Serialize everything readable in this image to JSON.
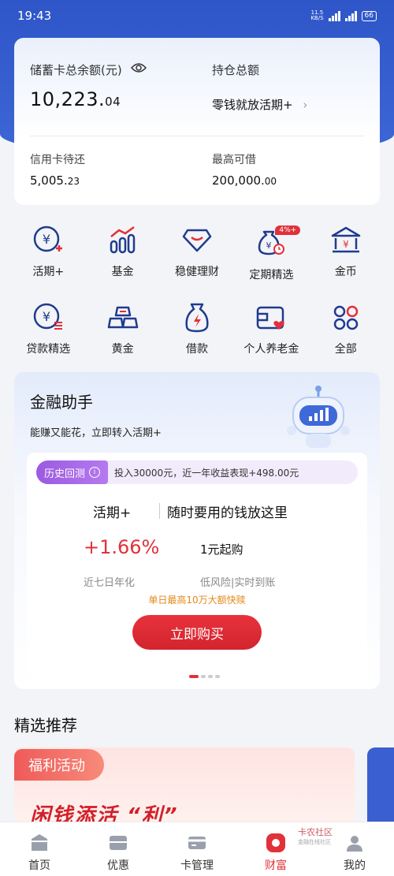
{
  "status_bar": {
    "time": "19:43",
    "net_speed": "11.5",
    "net_unit": "KB/S",
    "sig1": "5G",
    "sig2": "4G",
    "battery": "66"
  },
  "account": {
    "savings_label": "储蓄卡总余额(元)",
    "savings_int": "10,223.",
    "savings_dec": "04",
    "holdings_label": "持仓总额",
    "holdings_link": "零钱就放活期+",
    "credit_label": "信用卡待还",
    "credit_int": "5,005.",
    "credit_dec": "23",
    "max_label": "最高可借",
    "max_int": "200,000.",
    "max_dec": "00"
  },
  "grid": [
    {
      "label": "活期+",
      "icon": "yuan-plus-icon"
    },
    {
      "label": "基金",
      "icon": "fund-chart-icon"
    },
    {
      "label": "稳健理财",
      "icon": "diamond-icon"
    },
    {
      "label": "定期精选",
      "icon": "money-bag-clock-icon",
      "badge": "4%+"
    },
    {
      "label": "金币",
      "icon": "bank-icon"
    },
    {
      "label": "贷款精选",
      "icon": "yuan-coin-icon"
    },
    {
      "label": "黄金",
      "icon": "gold-bars-icon"
    },
    {
      "label": "借款",
      "icon": "bag-lightning-icon"
    },
    {
      "label": "个人养老金",
      "icon": "wallet-heart-icon"
    },
    {
      "label": "全部",
      "icon": "four-circles-icon"
    }
  ],
  "assistant": {
    "title": "金融助手",
    "subtitle": "能赚又能花，立即转入活期+",
    "history_tag": "历史回测",
    "history_info": "i",
    "history_text": "投入30000元，近一年收益表现+498.00元",
    "product": "活期+",
    "slogan": "随时要用的钱放这里",
    "rate": "+1.66%",
    "min_buy": "1元起购",
    "rate_label": "近七日年化",
    "risk_label": "低风险|实时到账",
    "promo": "单日最高10万大额快赎",
    "buy_button": "立即购买"
  },
  "recommend": {
    "title": "精选推荐",
    "promo_tag": "福利活动",
    "promo_text": "闲钱添活 “利”"
  },
  "tabs": [
    {
      "label": "首页",
      "icon": "home-icon"
    },
    {
      "label": "优惠",
      "icon": "coupon-icon"
    },
    {
      "label": "卡管理",
      "icon": "card-icon"
    },
    {
      "label": "财富",
      "icon": "wealth-icon",
      "active": true
    },
    {
      "label": "我的",
      "icon": "profile-icon"
    }
  ],
  "watermark": {
    "brand": "卡农社区",
    "sub": "金融在线社区"
  },
  "colors": {
    "primary_blue": "#2f56c8",
    "accent_red": "#e2313a",
    "purple": "#9b5ae0",
    "orange": "#e48a1b"
  }
}
